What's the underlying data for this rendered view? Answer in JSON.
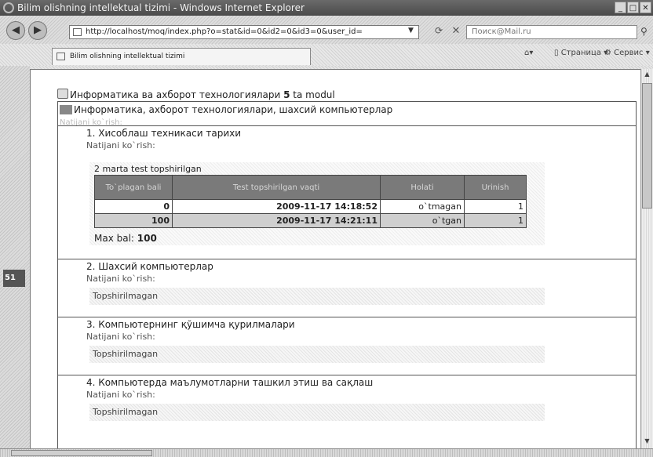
{
  "window": {
    "title": "Bilim olishning intellektual tizimi - Windows Internet Explorer",
    "minimize": "_",
    "maximize": "□",
    "close": "✕"
  },
  "nav": {
    "back_icon": "back-arrow",
    "forward_icon": "forward-arrow",
    "url": "http://localhost/moq/index.php?o=stat&id=0&id2=0&id3=0&user_id=",
    "search_placeholder": "Поиск@Mail.ru"
  },
  "tab": {
    "label": "Bilim olishning intellektual tizimi"
  },
  "toolbar": {
    "page_label": "Страница",
    "service_label": "Сервис"
  },
  "sidebar": {
    "badge": "51"
  },
  "content": {
    "course_prefix": "Информатика ва ахборот технологиялари ",
    "course_count": "5",
    "course_suffix": " ta modul",
    "module_title": "Информатика, ахборот технологиялари, шахсий компьютерлар",
    "module_link": "Natijani ko`rish:",
    "topics": [
      {
        "title": "1. Хисоблаш техникаси тарихи",
        "link": "Natijani ko`rish:",
        "test_count_text": "2 marta test topshirilgan",
        "table": {
          "headers": [
            "To`plagan bali",
            "Test topshirilgan vaqti",
            "Holati",
            "Urinish"
          ],
          "rows": [
            [
              "0",
              "2009-11-17 14:18:52",
              "o`tmagan",
              "1"
            ],
            [
              "100",
              "2009-11-17 14:21:11",
              "o`tgan",
              "1"
            ]
          ]
        },
        "maxbal_label": "Max bal: ",
        "maxbal_value": "100"
      },
      {
        "title": "2. Шахсий компьютерлар",
        "link": "Natijani ko`rish:",
        "status": "Topshirilmagan"
      },
      {
        "title": "3. Компьютернинг қўшимча қурилмалари",
        "link": "Natijani ko`rish:",
        "status": "Topshirilmagan"
      },
      {
        "title": "4. Компьютерда маълумотларни ташкил этиш ва сақлаш",
        "link": "Natijani ko`rish:",
        "status": "Topshirilmagan"
      }
    ]
  }
}
